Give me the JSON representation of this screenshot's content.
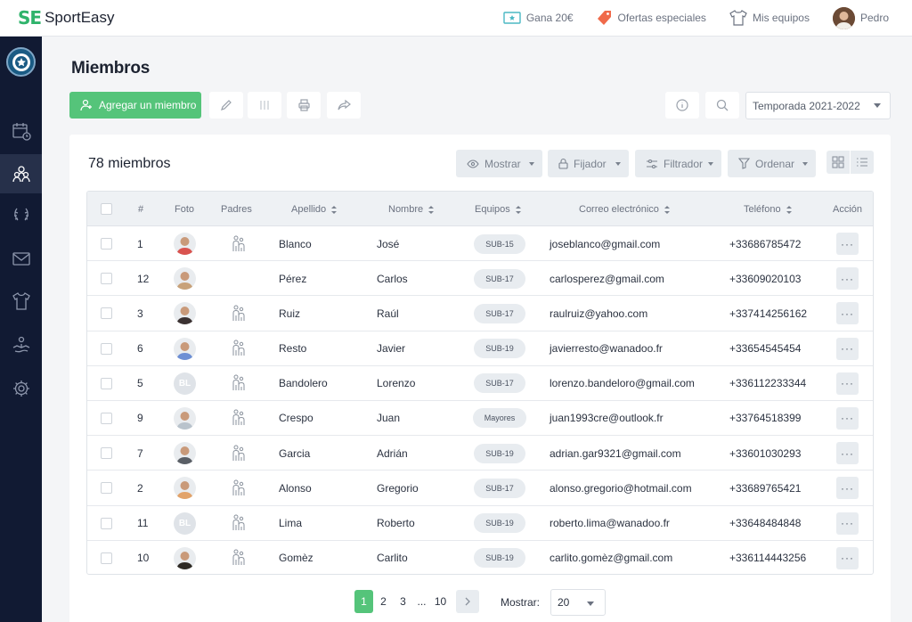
{
  "app": {
    "logo_mark": "SE",
    "name": "SportEasy"
  },
  "topnav": {
    "earn": "Gana 20€",
    "offers": "Ofertas especiales",
    "teams": "Mis equipos",
    "user": "Pedro"
  },
  "page": {
    "title": "Miembros",
    "add_button": "Agregar un miembro",
    "season": "Temporada 2021-2022"
  },
  "card": {
    "count": "78 miembros",
    "filters": {
      "show": "Mostrar",
      "pin": "Fijador",
      "filter": "Filtrador",
      "sort": "Ordenar"
    }
  },
  "table": {
    "headers": {
      "num": "#",
      "photo": "Foto",
      "parents": "Padres",
      "last": "Apellido",
      "first": "Nombre",
      "teams": "Equipos",
      "email": "Correo electrónico",
      "phone": "Teléfono",
      "action": "Acción"
    },
    "rows": [
      {
        "num": "1",
        "last": "Blanco",
        "first": "José",
        "team": "SUB-15",
        "email": "joseblanco@gmail.com",
        "phone": "+33686785472",
        "parents": true,
        "photo": "img",
        "photo_color": "#d9534f",
        "initials": ""
      },
      {
        "num": "12",
        "last": "Pérez",
        "first": "Carlos",
        "team": "SUB-17",
        "email": "carlosperez@gmail.com",
        "phone": "+33609020103",
        "parents": false,
        "photo": "img",
        "photo_color": "#c8a27a",
        "initials": ""
      },
      {
        "num": "3",
        "last": "Ruiz",
        "first": "Raúl",
        "team": "SUB-17",
        "email": "raulruiz@yahoo.com",
        "phone": "+337414256162",
        "parents": true,
        "photo": "img",
        "photo_color": "#3b3232",
        "initials": ""
      },
      {
        "num": "6",
        "last": "Resto",
        "first": "Javier",
        "team": "SUB-19",
        "email": "javierresto@wanadoo.fr",
        "phone": "+33654545454",
        "parents": true,
        "photo": "img",
        "photo_color": "#6d8fd4",
        "initials": ""
      },
      {
        "num": "5",
        "last": "Bandolero",
        "first": "Lorenzo",
        "team": "SUB-17",
        "email": "lorenzo.bandeloro@gmail.com",
        "phone": "+336112233344",
        "parents": true,
        "photo": "initials",
        "photo_color": "#dfe3e8",
        "initials": "BL"
      },
      {
        "num": "9",
        "last": "Crespo",
        "first": "Juan",
        "team": "Mayores",
        "email": "juan1993cre@outlook.fr",
        "phone": "+33764518399",
        "parents": true,
        "photo": "img",
        "photo_color": "#b9c3cc",
        "initials": ""
      },
      {
        "num": "7",
        "last": "Garcia",
        "first": "Adrián",
        "team": "SUB-19",
        "email": "adrian.gar9321@gmail.com",
        "phone": "+33601030293",
        "parents": true,
        "photo": "img",
        "photo_color": "#5a5f66",
        "initials": ""
      },
      {
        "num": "2",
        "last": "Alonso",
        "first": "Gregorio",
        "team": "SUB-17",
        "email": "alonso.gregorio@hotmail.com",
        "phone": "+33689765421",
        "parents": true,
        "photo": "img",
        "photo_color": "#e2a36a",
        "initials": ""
      },
      {
        "num": "11",
        "last": "Lima",
        "first": "Roberto",
        "team": "SUB-19",
        "email": "roberto.lima@wanadoo.fr",
        "phone": "+33648484848",
        "parents": true,
        "photo": "initials",
        "photo_color": "#dfe3e8",
        "initials": "BL"
      },
      {
        "num": "10",
        "last": "Gomèz",
        "first": "Carlito",
        "team": "SUB-19",
        "email": "carlito.gomèz@gmail.com",
        "phone": "+336114443256",
        "parents": true,
        "photo": "img",
        "photo_color": "#2e2a25",
        "initials": ""
      }
    ]
  },
  "pagination": {
    "pages": [
      "1",
      "2",
      "3",
      "...",
      "10"
    ],
    "show_label": "Mostrar:",
    "per_page": "20"
  },
  "colors": {
    "accent": "#55c47a",
    "sidebar": "#111a33",
    "logo": "#2fb36b"
  }
}
